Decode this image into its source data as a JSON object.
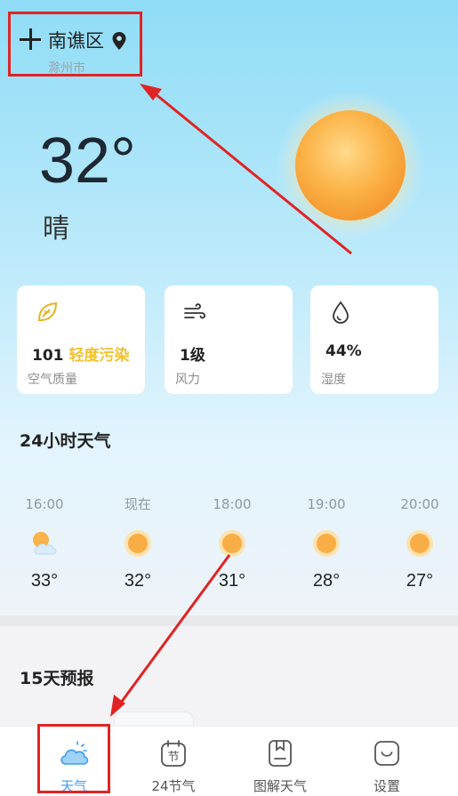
{
  "header": {
    "district": "南谯区",
    "city": "滁州市",
    "add_icon": "plus-icon",
    "location_icon": "map-pin-icon"
  },
  "current": {
    "temperature": "32°",
    "condition": "晴",
    "icon": "sun-icon"
  },
  "cards": [
    {
      "icon": "leaf-icon",
      "value": "101",
      "value_accent": "轻度污染",
      "label": "空气质量"
    },
    {
      "icon": "wind-icon",
      "value": "1级",
      "label": "风力"
    },
    {
      "icon": "droplet-icon",
      "value": "44%",
      "label": "湿度"
    }
  ],
  "hourly": {
    "title": "24小时天气",
    "items": [
      {
        "time": "16:00",
        "icon": "partly-cloudy-icon",
        "temp": "33°"
      },
      {
        "time": "现在",
        "icon": "sun-icon",
        "temp": "32°"
      },
      {
        "time": "18:00",
        "icon": "sun-icon",
        "temp": "31°"
      },
      {
        "time": "19:00",
        "icon": "sun-icon",
        "temp": "28°"
      },
      {
        "time": "20:00",
        "icon": "sun-icon",
        "temp": "27°"
      }
    ]
  },
  "forecast": {
    "title": "15天预报"
  },
  "tabs": [
    {
      "label": "天气",
      "icon": "cloud-icon",
      "active": true
    },
    {
      "label": "24节气",
      "icon": "solar-term-calendar-icon",
      "active": false
    },
    {
      "label": "图解天气",
      "icon": "bookmark-book-icon",
      "active": false
    },
    {
      "label": "设置",
      "icon": "smile-settings-icon",
      "active": false
    }
  ],
  "colors": {
    "accent_yellow": "#f3c12e",
    "tab_active_blue": "#3b9df0",
    "annotation_red": "#e02424",
    "sky_top": "#8fdcf6"
  }
}
